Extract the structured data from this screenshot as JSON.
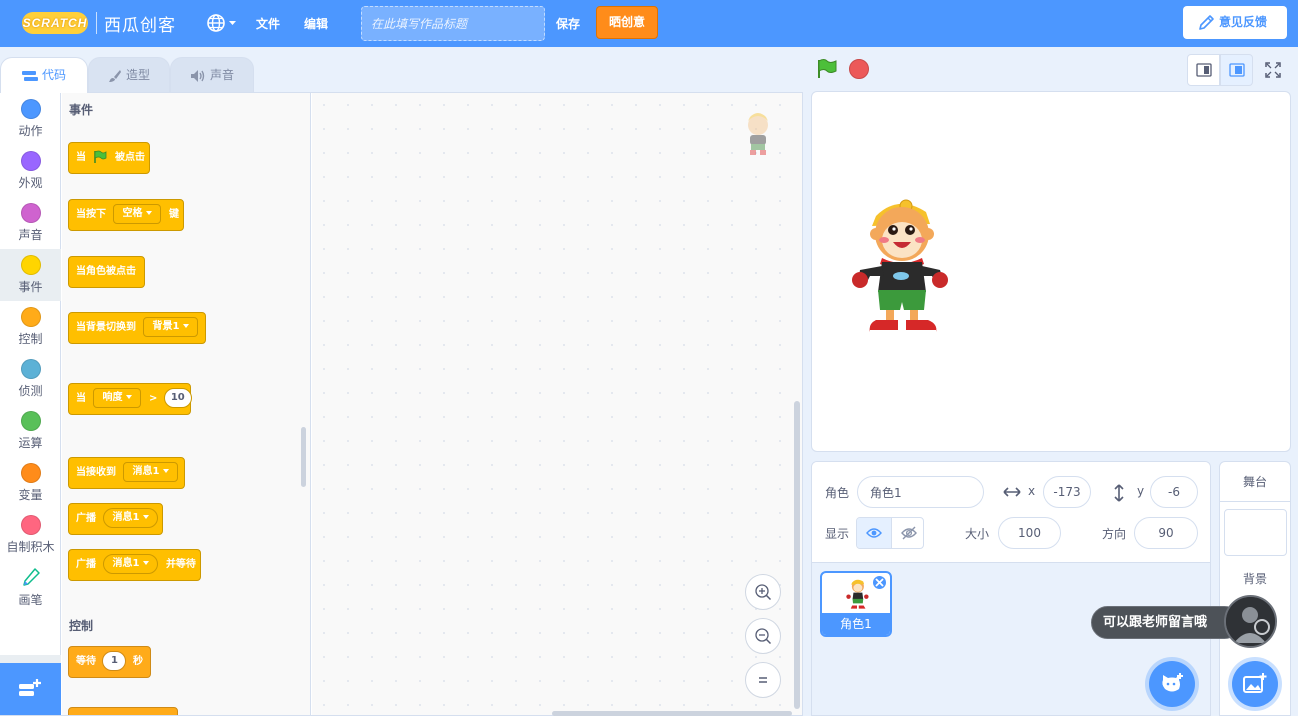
{
  "menubar": {
    "logo_text": "SCRATCH",
    "brand": "西瓜创客",
    "file": "文件",
    "edit": "编辑",
    "title_placeholder": "在此填写作品标题",
    "save": "保存",
    "share": "晒创意",
    "feedback": "意见反馈"
  },
  "tabs": [
    {
      "label": "代码"
    },
    {
      "label": "造型"
    },
    {
      "label": "声音"
    }
  ],
  "categories": [
    {
      "label": "动作",
      "color": "#4c97ff"
    },
    {
      "label": "外观",
      "color": "#9966ff"
    },
    {
      "label": "声音",
      "color": "#cf63cf"
    },
    {
      "label": "事件",
      "color": "#ffd500"
    },
    {
      "label": "控制",
      "color": "#ffab19"
    },
    {
      "label": "侦测",
      "color": "#5cb1d6"
    },
    {
      "label": "运算",
      "color": "#59c059"
    },
    {
      "label": "变量",
      "color": "#ff8c1a"
    },
    {
      "label": "自制积木",
      "color": "#ff6680"
    },
    {
      "label": "画笔",
      "color": "#0fbd8c"
    }
  ],
  "palette": {
    "events_title": "事件",
    "control_title": "控制",
    "blocks": {
      "flag_pre": "当",
      "flag_post": "被点击",
      "key_pre": "当按下",
      "key_value": "空格",
      "key_post": "键",
      "sprite_click": "当角色被点击",
      "backdrop_pre": "当背景切换到",
      "backdrop_value": "背景1",
      "loud_pre": "当",
      "loud_value": "响度",
      "loud_op": ">",
      "loud_num": "10",
      "receive_pre": "当接收到",
      "receive_value": "消息1",
      "broadcast": "广播",
      "broadcast_value": "消息1",
      "broadcast_wait": "广播",
      "broadcast_wait_value": "消息1",
      "broadcast_wait_post": "并等待",
      "wait_pre": "等待",
      "wait_num": "1",
      "wait_post": "秒"
    }
  },
  "sprite": {
    "label_sprite": "角色",
    "name": "角色1",
    "x_label": "x",
    "x": "-173",
    "y_label": "y",
    "y": "-6",
    "show_label": "显示",
    "size_label": "大小",
    "size": "100",
    "direction_label": "方向",
    "direction": "90",
    "card_name": "角色1"
  },
  "stage_pane": {
    "title": "舞台",
    "backdrops_label": "背景"
  },
  "bubble": {
    "text": "可以跟老师留言哦"
  }
}
